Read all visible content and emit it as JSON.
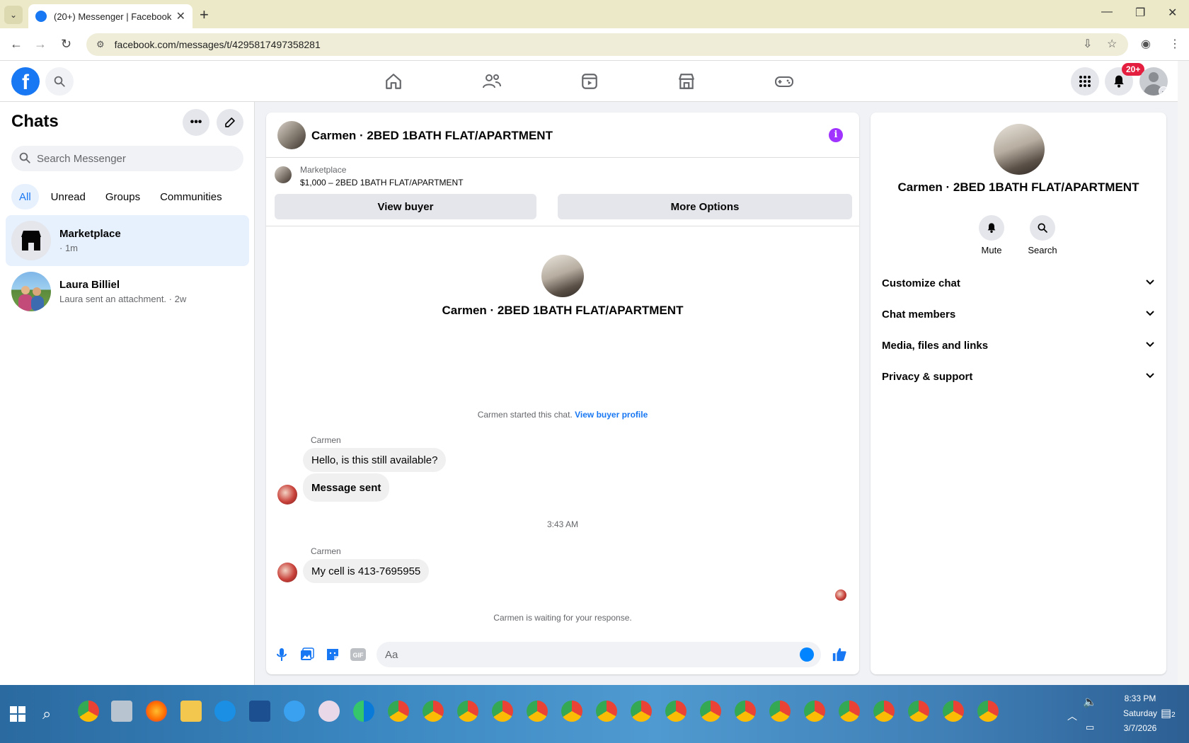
{
  "browser": {
    "tab_title": "(20+) Messenger | Facebook",
    "url": "facebook.com/messages/t/4295817497358281"
  },
  "fbnav": {
    "logo_letter": "f",
    "notif_badge": "20+"
  },
  "sidebar": {
    "title": "Chats",
    "search_placeholder": "Search Messenger",
    "filters": [
      "All",
      "Unread",
      "Groups",
      "Communities"
    ],
    "chats": [
      {
        "name": "Marketplace",
        "subtitle": "· 1m"
      },
      {
        "name": "Laura Billiel",
        "subtitle": "Laura sent an attachment. · 2w"
      }
    ]
  },
  "chat": {
    "header_name": "Carmen · 2BED 1BATH FLAT/APARTMENT",
    "marketplace_label": "Marketplace",
    "listing": "$1,000 – 2BED 1BATH FLAT/APARTMENT",
    "view_buyer_label": "View buyer",
    "more_options_label": "More Options",
    "center_name": "Carmen · 2BED 1BATH FLAT/APARTMENT",
    "started_text": "Carmen started this chat.",
    "view_profile_link": "View buyer profile",
    "sender_1": "Carmen",
    "msg_1": "Hello, is this still available?",
    "msg_2": "Message sent",
    "timestamp": "3:43 AM",
    "sender_2": "Carmen",
    "msg_3": "My cell is 413-7695955",
    "waiting_text": "Carmen is waiting for your response.",
    "composer_placeholder": "Aa"
  },
  "info": {
    "name": "Carmen · 2BED 1BATH FLAT/APARTMENT",
    "mute_label": "Mute",
    "search_label": "Search",
    "sections": [
      "Customize chat",
      "Chat members",
      "Media, files and links",
      "Privacy & support"
    ]
  },
  "taskbar": {
    "time": "8:33 PM",
    "day": "Saturday",
    "date": "3/7/2026",
    "notif_count": "2"
  },
  "colors": {
    "fb_blue": "#1877f2",
    "messenger_purple": "#a033ff",
    "badge_red": "#e41e3f"
  }
}
